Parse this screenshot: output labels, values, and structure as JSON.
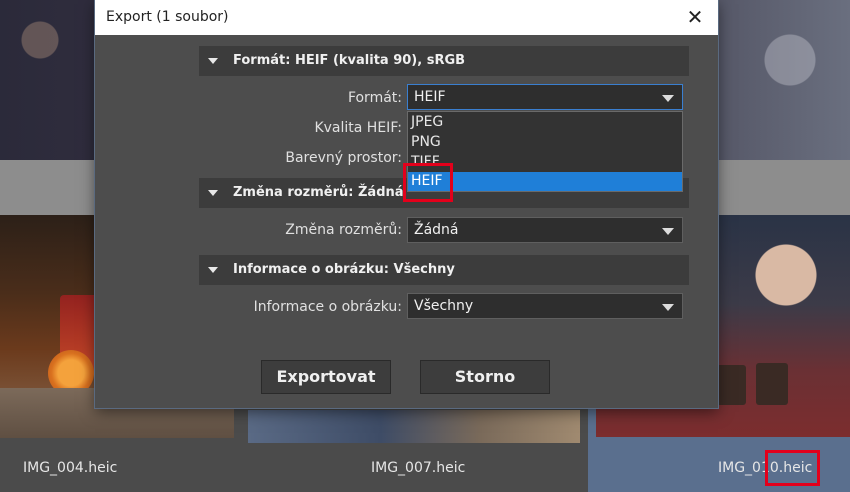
{
  "dialog": {
    "title": "Export (1 soubor)",
    "close_label": "✕"
  },
  "sections": {
    "format": "Formát: HEIF (kvalita 90), sRGB",
    "resize": "Změna rozměrů: Žádná",
    "info": "Informace o obrázku: Všechny"
  },
  "fields": {
    "format_label": "Formát:",
    "format_value": "HEIF",
    "quality_label": "Kvalita HEIF:",
    "colorspace_label": "Barevný prostor:",
    "resize_label": "Změna rozměrů:",
    "resize_value": "Žádná",
    "info_label": "Informace o obrázku:",
    "info_value": "Všechny"
  },
  "format_options": [
    "JPEG",
    "PNG",
    "TIFF",
    "HEIF"
  ],
  "selected_format": "HEIF",
  "buttons": {
    "export": "Exportovat",
    "cancel": "Storno"
  },
  "gallery": {
    "captions": [
      "IMG_004.heic",
      "IMG_007.heic",
      "IMG_010.heic"
    ],
    "selected": "IMG_010.heic"
  },
  "colors": {
    "accent": "#1f7fd8",
    "highlight": "#e3001b",
    "selection": "#5a6f8e"
  }
}
